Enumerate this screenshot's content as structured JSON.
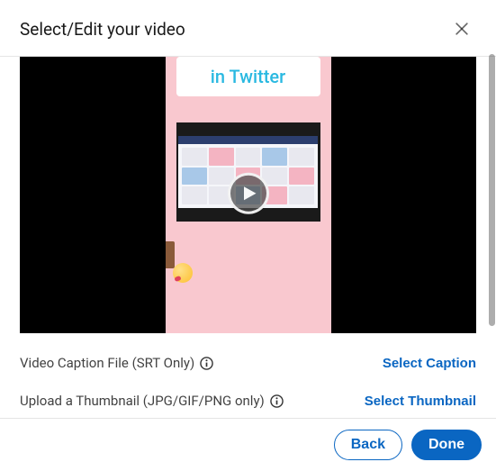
{
  "modal": {
    "title": "Select/Edit your video"
  },
  "video": {
    "banner_text": "in Twitter"
  },
  "rows": {
    "caption_label": "Video Caption File (SRT Only)",
    "caption_action": "Select Caption",
    "thumb_label": "Upload a Thumbnail (JPG/GIF/PNG only)",
    "thumb_action": "Select Thumbnail"
  },
  "footer": {
    "back": "Back",
    "done": "Done"
  }
}
